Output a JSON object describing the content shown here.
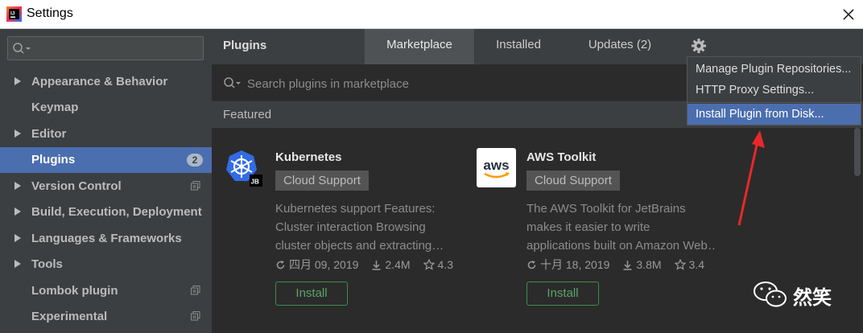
{
  "window": {
    "title": "Settings"
  },
  "sidebar": {
    "search_value": "",
    "items": [
      {
        "label": "Appearance & Behavior",
        "expandable": true
      },
      {
        "label": "Keymap",
        "expandable": false
      },
      {
        "label": "Editor",
        "expandable": true
      },
      {
        "label": "Plugins",
        "expandable": false,
        "selected": true,
        "badge": "2"
      },
      {
        "label": "Version Control",
        "expandable": true,
        "copy_icon": true
      },
      {
        "label": "Build, Execution, Deployment",
        "expandable": true
      },
      {
        "label": "Languages & Frameworks",
        "expandable": true
      },
      {
        "label": "Tools",
        "expandable": true
      },
      {
        "label": "Lombok plugin",
        "expandable": false,
        "copy_icon": true
      },
      {
        "label": "Experimental",
        "expandable": false,
        "copy_icon": true
      }
    ]
  },
  "main": {
    "title": "Plugins",
    "tabs": [
      {
        "label": "Marketplace",
        "active": true
      },
      {
        "label": "Installed",
        "active": false
      },
      {
        "label": "Updates (2)",
        "active": false
      }
    ],
    "search": {
      "placeholder": "Search plugins in marketplace",
      "value": ""
    },
    "section_label": "Featured",
    "plugins": [
      {
        "name": "Kubernetes",
        "tag": "Cloud Support",
        "description": [
          "Kubernetes support Features:",
          "Cluster interaction Browsing",
          "cluster objects and extracting…"
        ],
        "updated": "四月 09, 2019",
        "downloads": "2.4M",
        "rating": "4.3",
        "install_label": "Install",
        "logo": "kubernetes-helm-icon"
      },
      {
        "name": "AWS Toolkit",
        "tag": "Cloud Support",
        "description": [
          "The AWS Toolkit for JetBrains",
          "makes it easier to write",
          "applications built on Amazon Web…"
        ],
        "updated": "十月 18, 2019",
        "downloads": "3.8M",
        "rating": "3.4",
        "install_label": "Install",
        "logo": "aws-icon",
        "logo_text": "aws"
      }
    ]
  },
  "gear_menu": {
    "items": [
      {
        "label": "Manage Plugin Repositories..."
      },
      {
        "label": "HTTP Proxy Settings..."
      },
      {
        "label": "Install Plugin from Disk...",
        "highlighted": true
      }
    ]
  },
  "watermark": {
    "text": "然笑"
  },
  "colors": {
    "selection": "#4b6eaf",
    "install_green": "#5aa469",
    "annotation_red": "#e8282b"
  }
}
